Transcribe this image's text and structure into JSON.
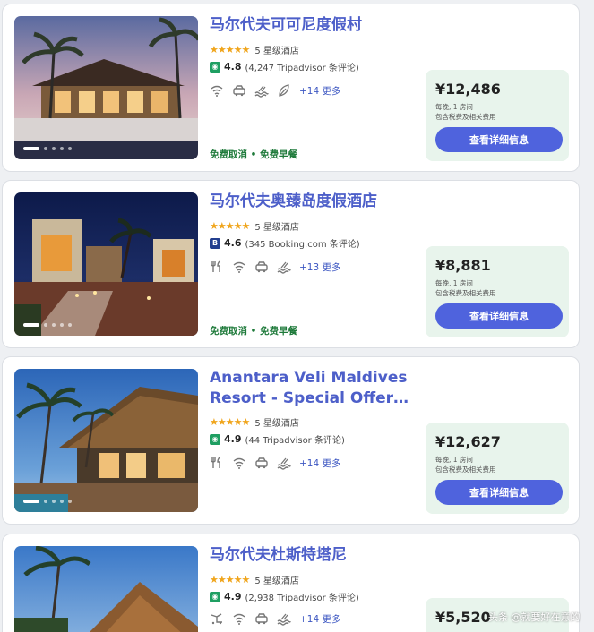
{
  "colors": {
    "title": "#4d5fc9",
    "button": "#4f63dd",
    "price_bg": "#e8f4ec",
    "perk_green": "#1e7a3a",
    "star": "#f0a51c"
  },
  "hotels": [
    {
      "name": "马尔代夫可可尼度假村",
      "stars": "★★★★★",
      "star_label": "5 星级酒店",
      "rating_source_icon": "tripadvisor-icon",
      "score": "4.8",
      "reviews": "(4,247 Tripadvisor 条评论)",
      "amenities": [
        "wifi-icon",
        "car-icon",
        "pool-icon",
        "spa-leaf-icon"
      ],
      "more": "+14 更多",
      "perks": "免费取消 • 免费早餐",
      "price": "¥12,486",
      "price_note_1": "每晚, 1 房间",
      "price_note_2": "包含税费及相关费用",
      "button": "查看详细信息"
    },
    {
      "name": "马尔代夫奥臻岛度假酒店",
      "stars": "★★★★★",
      "star_label": "5 星级酒店",
      "rating_source_icon": "booking-icon",
      "score": "4.6",
      "reviews": "(345 Booking.com 条评论)",
      "amenities": [
        "restaurant-icon",
        "wifi-icon",
        "car-icon",
        "pool-icon"
      ],
      "more": "+13 更多",
      "perks": "免费取消 • 免费早餐",
      "price": "¥8,881",
      "price_note_1": "每晚, 1 房间",
      "price_note_2": "包含税费及相关费用",
      "button": "查看详细信息"
    },
    {
      "name": "Anantara Veli Maldives Resort - Special Offer On...",
      "stars": "★★★★★",
      "star_label": "5 星级酒店",
      "rating_source_icon": "tripadvisor-icon",
      "score": "4.9",
      "reviews": "(44 Tripadvisor 条评论)",
      "amenities": [
        "restaurant-icon",
        "wifi-icon",
        "car-icon",
        "pool-icon"
      ],
      "more": "+14 更多",
      "perks": "",
      "price": "¥12,627",
      "price_note_1": "每晚, 1 房间",
      "price_note_2": "包含税费及相关费用",
      "button": "查看详细信息"
    },
    {
      "name": "马尔代夫杜斯特塔尼",
      "stars": "★★★★★",
      "star_label": "5 星级酒店",
      "rating_source_icon": "tripadvisor-icon",
      "score": "4.9",
      "reviews": "(2,938 Tripadvisor 条评论)",
      "amenities": [
        "airport-shuttle-icon",
        "wifi-icon",
        "car-icon",
        "pool-icon"
      ],
      "more": "+14 更多",
      "perks": "",
      "price": "¥5,520",
      "price_note_1": "",
      "price_note_2": "",
      "button": ""
    }
  ],
  "watermark": "头条 @就要好在意的"
}
